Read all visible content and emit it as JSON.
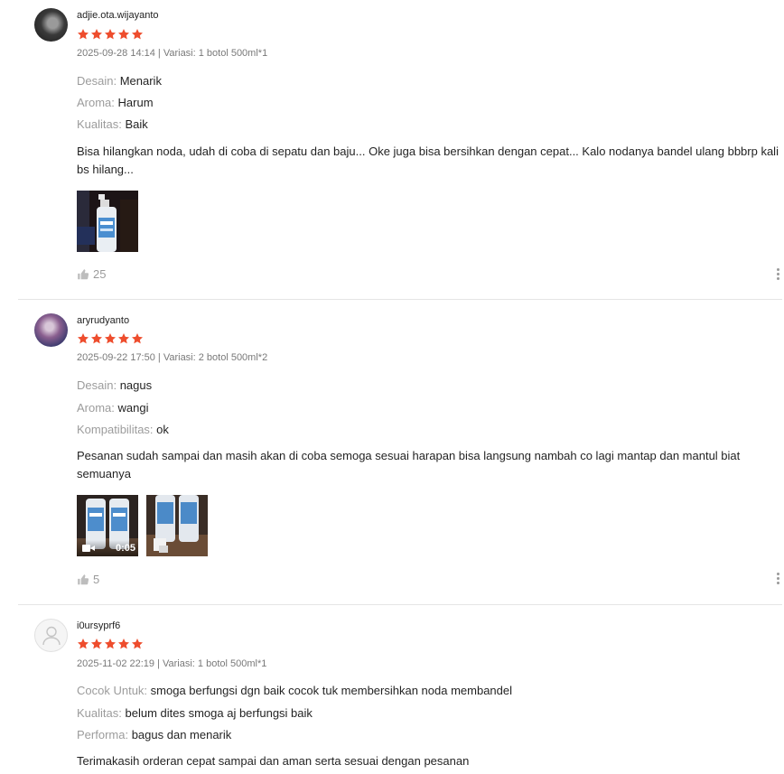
{
  "colors": {
    "star": "#ee4d2d",
    "label": "rgba(0,0,0,0.4)",
    "divider": "#e5e5e5"
  },
  "reviews": [
    {
      "username": "adjie.ota.wijayanto",
      "rating": 5,
      "meta": "2025-09-28 14:14 | Variasi: 1 botol 500ml*1",
      "attributes": [
        {
          "key": "Desain:",
          "value": "Menarik"
        },
        {
          "key": "Aroma:",
          "value": "Harum"
        },
        {
          "key": "Kualitas:",
          "value": "Baik"
        }
      ],
      "content": "Bisa hilangkan noda, udah di coba di sepatu dan baju... Oke juga bisa bersihkan dengan cepat... Kalo nodanya bandel ulang bbbrp kali bs hilang...",
      "likes": "25",
      "media_icons": [
        "product-photo"
      ]
    },
    {
      "username": "aryrudyanto",
      "rating": 5,
      "meta": "2025-09-22 17:50 | Variasi: 2 botol 500ml*2",
      "attributes": [
        {
          "key": "Desain:",
          "value": "nagus"
        },
        {
          "key": "Aroma:",
          "value": "wangi"
        },
        {
          "key": "Kompatibilitas:",
          "value": "ok"
        }
      ],
      "content": "Pesanan sudah sampai dan masih akan di coba semoga sesuai harapan bisa langsung nambah co lagi mantap dan mantul biat semuanya",
      "video_duration": "0:05",
      "likes": "5",
      "media_icons": [
        "video-thumbnail",
        "product-photo"
      ]
    },
    {
      "username": "i0ursyprf6",
      "rating": 5,
      "meta": "2025-11-02 22:19 | Variasi: 1 botol 500ml*1",
      "attributes": [
        {
          "key": "Cocok Untuk:",
          "value": "smoga berfungsi dgn baik cocok tuk membersihkan noda membandel"
        },
        {
          "key": "Kualitas:",
          "value": "belum dites smoga aj berfungsi baik"
        },
        {
          "key": "Performa:",
          "value": "bagus dan menarik"
        }
      ],
      "content": "Terimakasih orderan cepat sampai dan aman serta sesuai dengan pesanan"
    }
  ]
}
